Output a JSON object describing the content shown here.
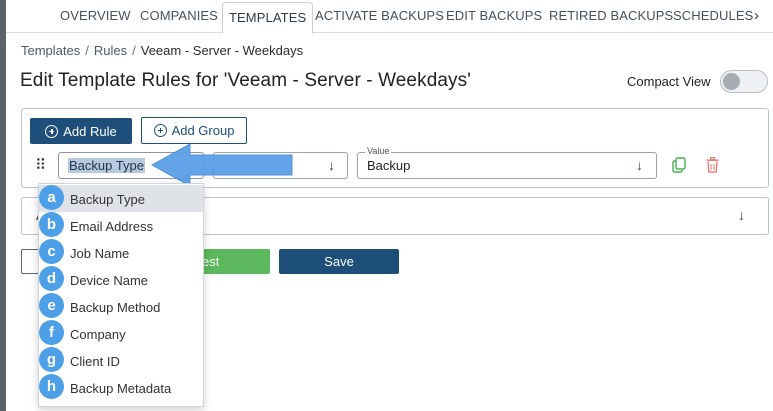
{
  "tabs": {
    "items": [
      {
        "label": "OVERVIEW"
      },
      {
        "label": "COMPANIES"
      },
      {
        "label": "TEMPLATES"
      },
      {
        "label": "ACTIVATE BACKUPS"
      },
      {
        "label": "EDIT BACKUPS"
      },
      {
        "label": "RETIRED BACKUPS"
      },
      {
        "label": "SCHEDULES"
      }
    ],
    "active": "TEMPLATES",
    "more_glyph": "›"
  },
  "breadcrumb": {
    "items": [
      "Templates",
      "Rules"
    ],
    "separator": "/",
    "current": "Veeam - Server - Weekdays"
  },
  "page_title": "Edit Template Rules for 'Veeam - Server - Weekdays'",
  "compact_view": {
    "label": "Compact View",
    "enabled": false
  },
  "rule_builder": {
    "add_rule_label": "Add Rule",
    "add_group_label": "Add Group",
    "drag_glyph": "⠿",
    "field_value": "Backup Type",
    "operator_value": "",
    "value_legend": "Value",
    "value_text": "Backup",
    "arrow_glyph": "↓",
    "copy_color": "#4caf50",
    "delete_color": "#e57373"
  },
  "second_row": {
    "partial_text": "A",
    "arrow_glyph": "↓"
  },
  "actions": {
    "test_label": "Test",
    "test_visible_text": "est",
    "save_label": "Save"
  },
  "dropdown": {
    "items": [
      {
        "badge": "a",
        "label": "Backup Type",
        "selected": true
      },
      {
        "badge": "b",
        "label": "Email Address"
      },
      {
        "badge": "c",
        "label": "Job Name"
      },
      {
        "badge": "d",
        "label": "Device Name"
      },
      {
        "badge": "e",
        "label": "Backup Method"
      },
      {
        "badge": "f",
        "label": "Company"
      },
      {
        "badge": "g",
        "label": "Client ID"
      },
      {
        "badge": "h",
        "label": "Backup Metadata"
      }
    ]
  },
  "annotation": {
    "badge_color": "#4da0e8",
    "arrow_color": "#5b9fe6"
  }
}
